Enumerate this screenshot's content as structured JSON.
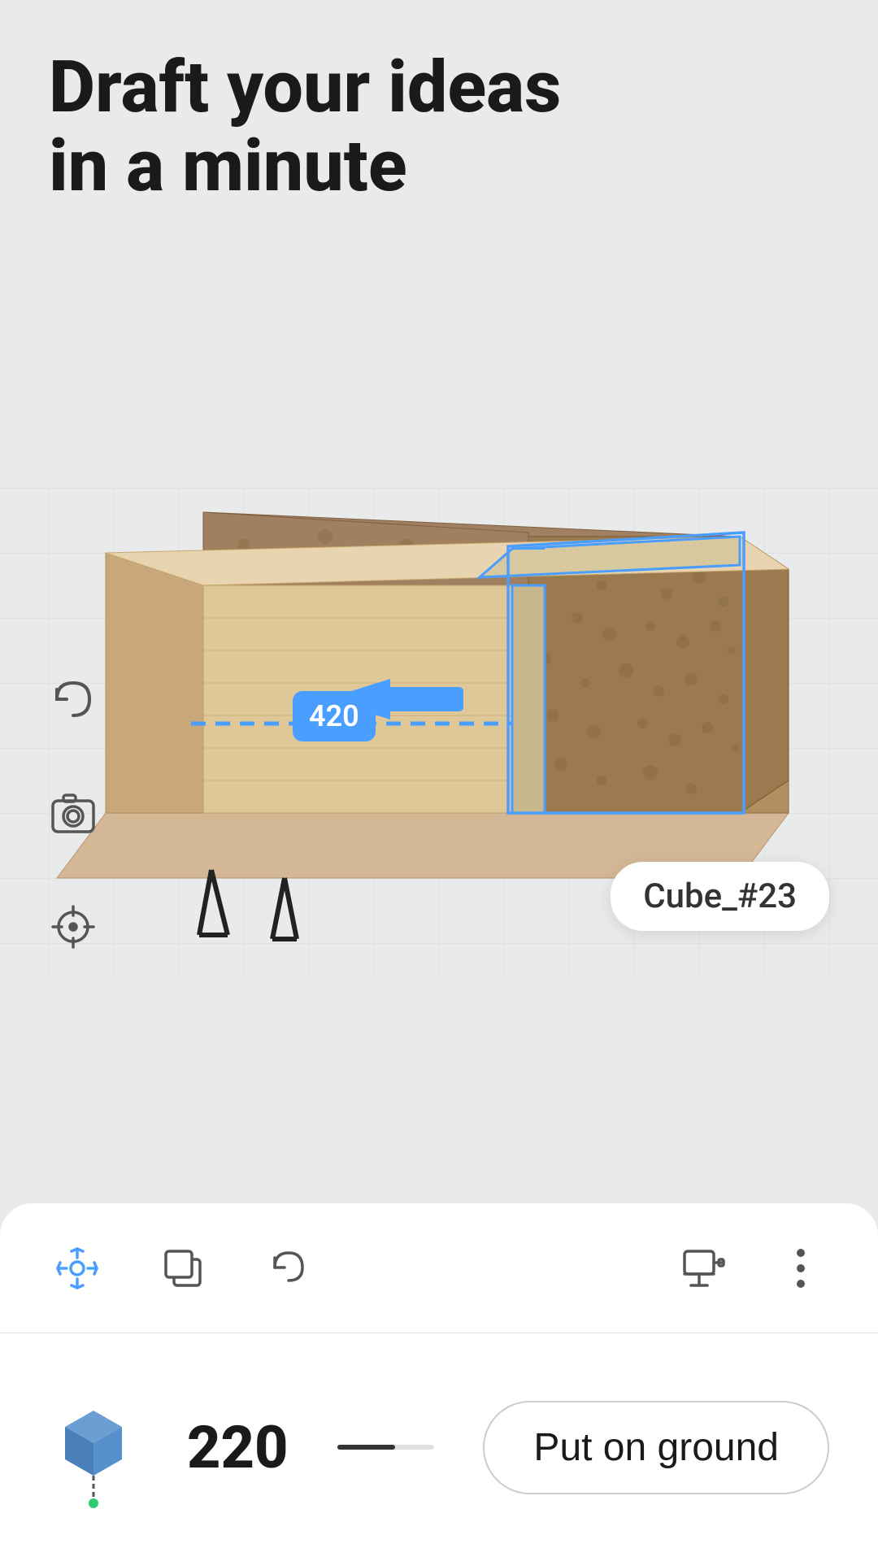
{
  "heading": {
    "line1": "Draft your ideas",
    "line2": "in a minute"
  },
  "scene": {
    "cube_label": "Cube_#23",
    "measurement": "420",
    "measurement_unit": ""
  },
  "toolbar": {
    "icons": [
      {
        "name": "move-icon",
        "label": "Move"
      },
      {
        "name": "duplicate-icon",
        "label": "Duplicate"
      },
      {
        "name": "undo-icon",
        "label": "Undo"
      }
    ],
    "right_icons": [
      {
        "name": "paint-icon",
        "label": "Paint"
      },
      {
        "name": "more-icon",
        "label": "More"
      }
    ]
  },
  "action_bar": {
    "height_value": "220",
    "put_on_ground_label": "Put on ground"
  },
  "colors": {
    "blue_accent": "#4a9eff",
    "background": "#e8eaec",
    "panel_bg": "#ffffff",
    "icon_color": "#555555"
  }
}
